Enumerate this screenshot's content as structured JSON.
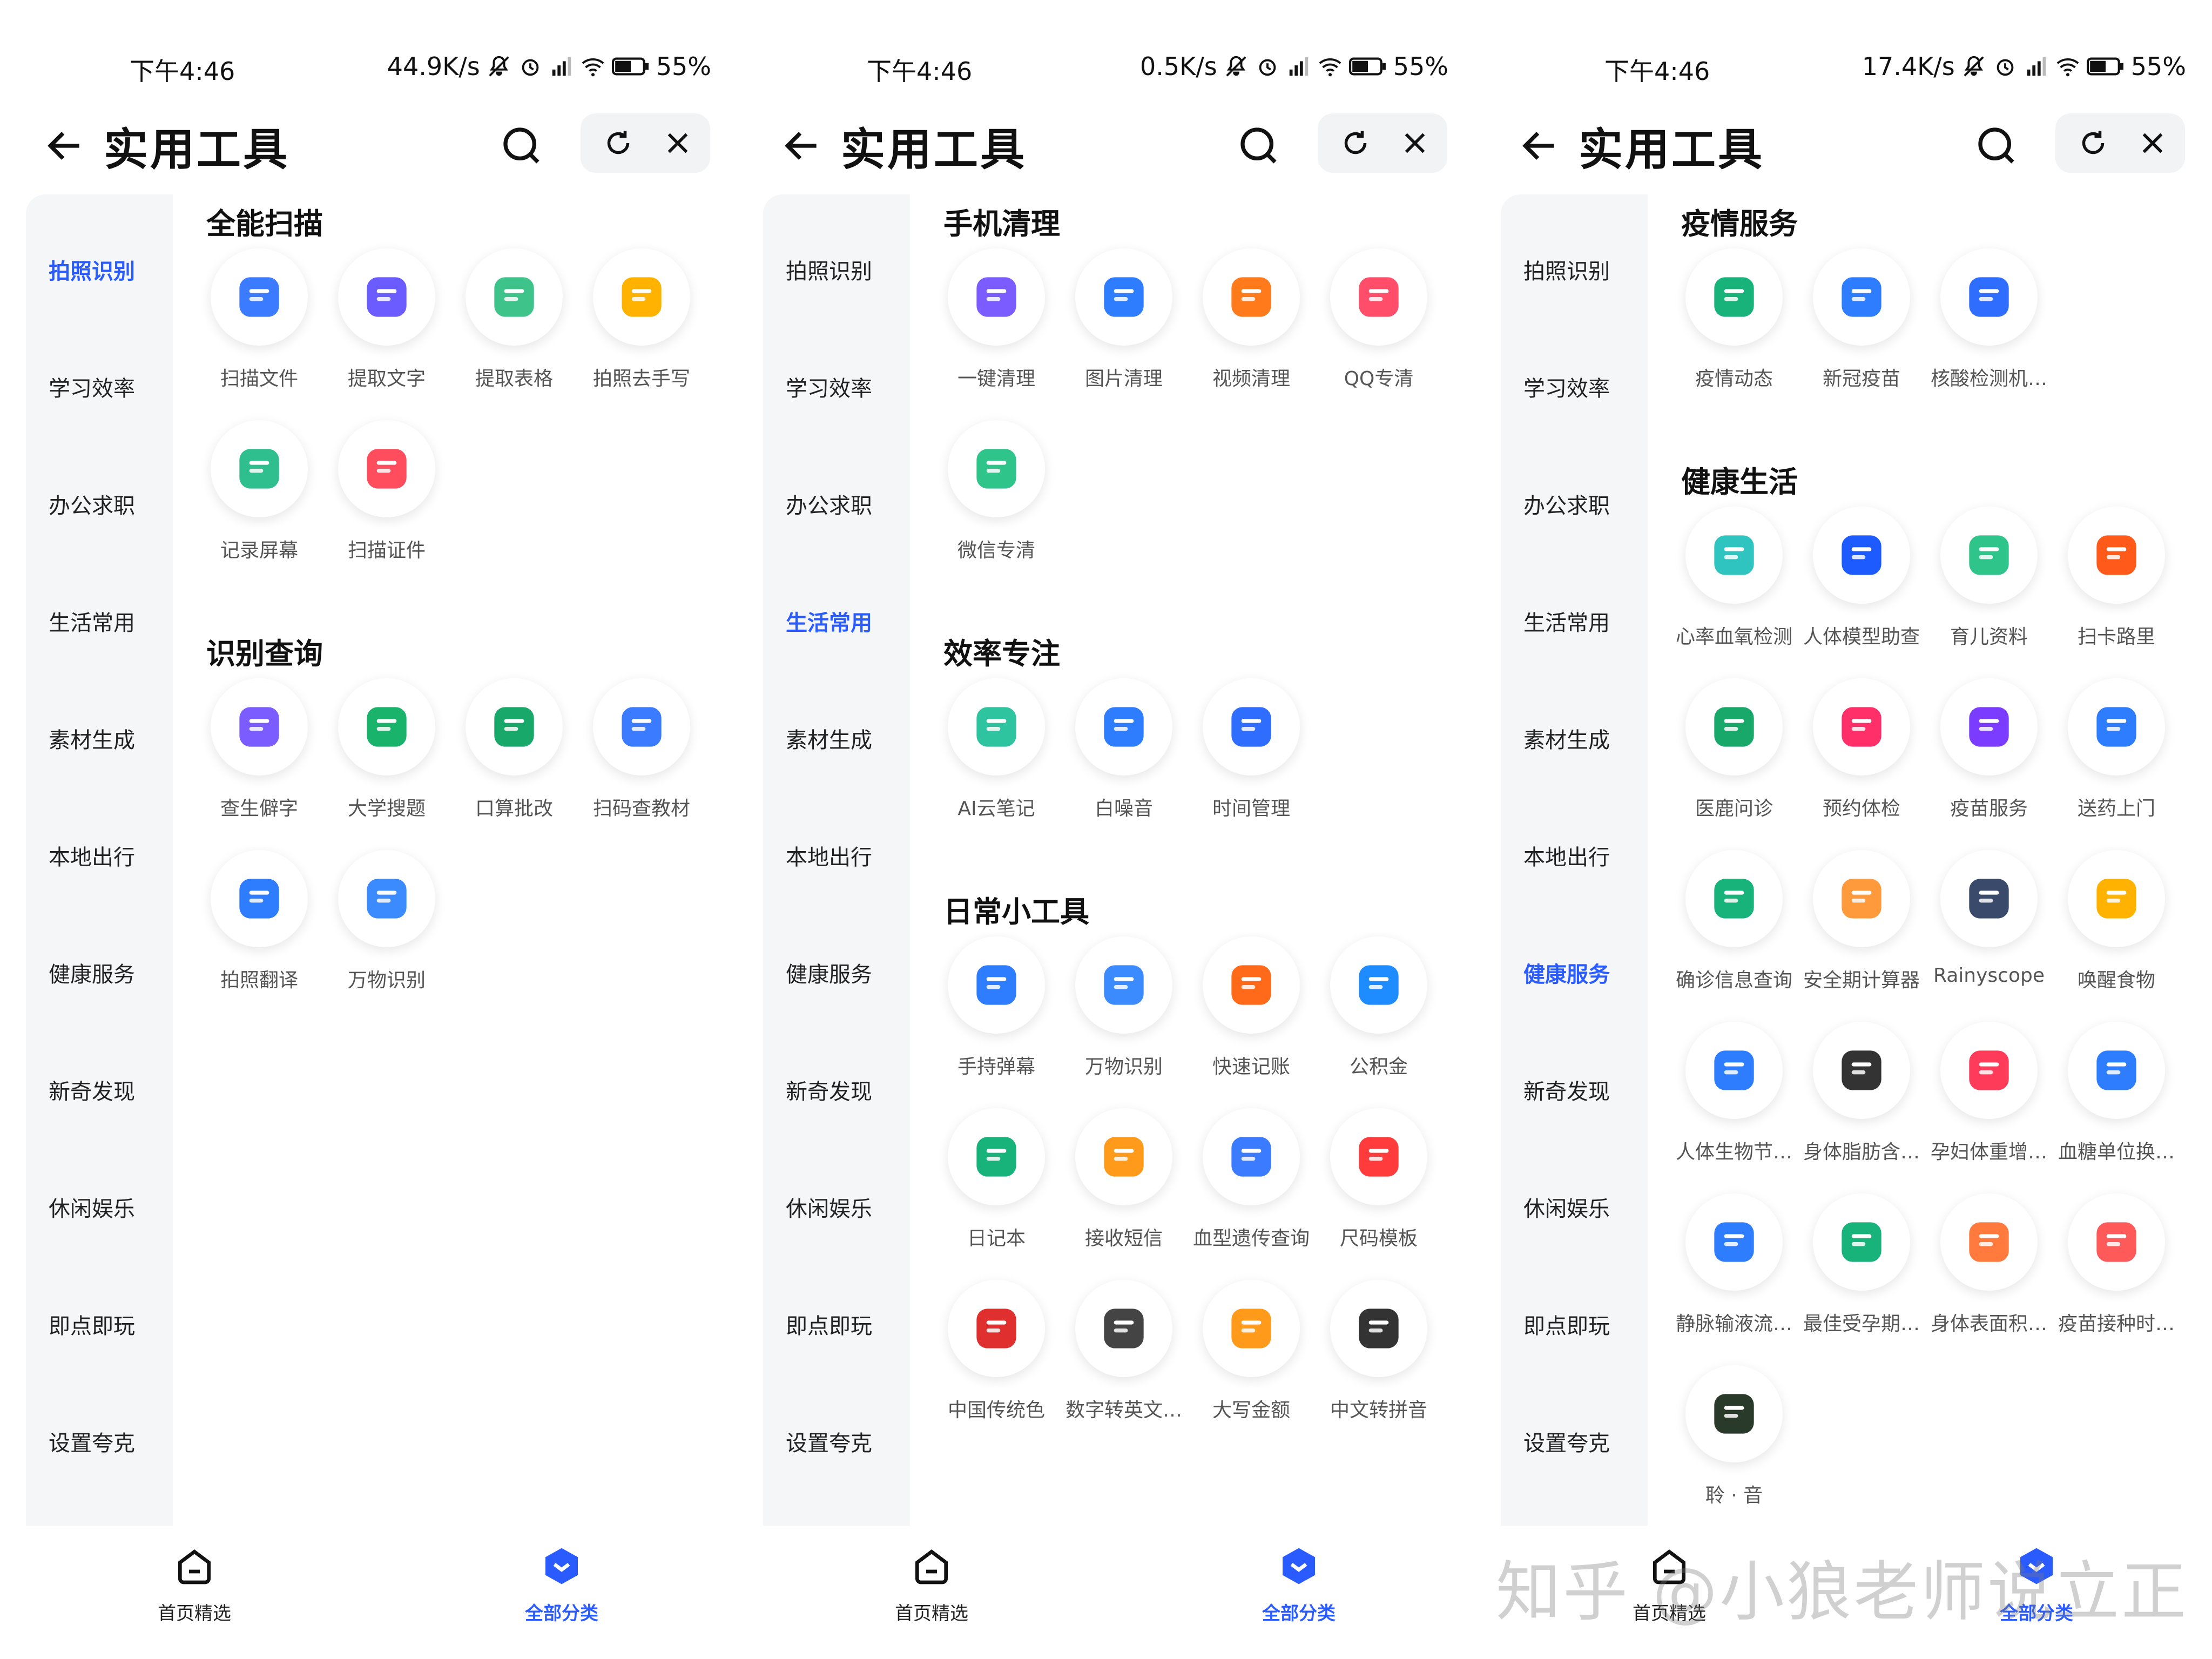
{
  "colors": {
    "accent": "#2a5bff",
    "sidebar_bg": "#f5f6f8",
    "capsule_bg": "#f2f3f5"
  },
  "screens": [
    {
      "status": {
        "time": "下午4:46",
        "speed": "44.9K/s",
        "battery": "55%"
      },
      "header": {
        "title": "实用工具"
      },
      "sidebar": [
        "拍照识别",
        "学习效率",
        "办公求职",
        "生活常用",
        "素材生成",
        "本地出行",
        "健康服务",
        "新奇发现",
        "休闲娱乐",
        "即点即玩",
        "设置夸克"
      ],
      "active_sidebar": 0,
      "sections": [
        {
          "title": "全能扫描",
          "items": [
            {
              "label": "扫描文件",
              "icon": "scan-file-icon",
              "color": "#3b7bff"
            },
            {
              "label": "提取文字",
              "icon": "extract-text-icon",
              "color": "#6a5cff"
            },
            {
              "label": "提取表格",
              "icon": "extract-table-icon",
              "color": "#3ec48a"
            },
            {
              "label": "拍照去手写",
              "icon": "remove-handwriting-icon",
              "color": "#ffb300"
            },
            {
              "label": "记录屏幕",
              "icon": "record-screen-icon",
              "color": "#2fbf8f"
            },
            {
              "label": "扫描证件",
              "icon": "scan-id-icon",
              "color": "#ff4d5e"
            }
          ]
        },
        {
          "title": "识别查询",
          "items": [
            {
              "label": "查生僻字",
              "icon": "rare-char-icon",
              "color": "#7b5cff"
            },
            {
              "label": "大学搜题",
              "icon": "college-search-icon",
              "color": "#19b36b"
            },
            {
              "label": "口算批改",
              "icon": "mental-math-icon",
              "color": "#17a86a"
            },
            {
              "label": "扫码查教材",
              "icon": "barcode-textbook-icon",
              "color": "#3b7bff"
            },
            {
              "label": "拍照翻译",
              "icon": "photo-translate-icon",
              "color": "#2f7dff"
            },
            {
              "label": "万物识别",
              "icon": "object-recognize-icon",
              "color": "#3b8bff"
            }
          ]
        }
      ]
    },
    {
      "status": {
        "time": "下午4:46",
        "speed": "0.5K/s",
        "battery": "55%"
      },
      "header": {
        "title": "实用工具"
      },
      "sidebar": [
        "拍照识别",
        "学习效率",
        "办公求职",
        "生活常用",
        "素材生成",
        "本地出行",
        "健康服务",
        "新奇发现",
        "休闲娱乐",
        "即点即玩",
        "设置夸克"
      ],
      "active_sidebar": 3,
      "sections": [
        {
          "title": "手机清理",
          "items": [
            {
              "label": "一键清理",
              "icon": "rocket-icon",
              "color": "#7b5cff"
            },
            {
              "label": "图片清理",
              "icon": "image-icon",
              "color": "#2f7dff"
            },
            {
              "label": "视频清理",
              "icon": "video-icon",
              "color": "#ff7a1a"
            },
            {
              "label": "QQ专清",
              "icon": "qq-icon",
              "color": "#ff4d6a"
            },
            {
              "label": "微信专清",
              "icon": "wechat-icon",
              "color": "#2fc48a"
            }
          ]
        },
        {
          "title": "效率专注",
          "items": [
            {
              "label": "AI云笔记",
              "icon": "ai-note-icon",
              "color": "#2fc4a0"
            },
            {
              "label": "白噪音",
              "icon": "white-noise-icon",
              "color": "#2f7dff"
            },
            {
              "label": "时间管理",
              "icon": "alarm-clock-icon",
              "color": "#2f6dff"
            }
          ]
        },
        {
          "title": "日常小工具",
          "items": [
            {
              "label": "手持弹幕",
              "icon": "bullet-screen-icon",
              "color": "#2f7dff"
            },
            {
              "label": "万物识别",
              "icon": "object-recognize-icon",
              "color": "#3b8bff"
            },
            {
              "label": "快速记账",
              "icon": "accounting-icon",
              "color": "#ff6a1a"
            },
            {
              "label": "公积金",
              "icon": "housing-fund-icon",
              "color": "#1e8cff"
            },
            {
              "label": "日记本",
              "icon": "diary-icon",
              "color": "#17b37a"
            },
            {
              "label": "接收短信",
              "icon": "sms-icon",
              "color": "#ff9a1a"
            },
            {
              "label": "血型遗传查询",
              "icon": "blood-type-icon",
              "color": "#3b7bff"
            },
            {
              "label": "尺码模板",
              "icon": "size-template-icon",
              "color": "#ff3b3b"
            },
            {
              "label": "中国传统色",
              "icon": "chinese-knot-icon",
              "color": "#e02f2f"
            },
            {
              "label": "数字转英文…",
              "icon": "number-english-icon",
              "color": "#444444"
            },
            {
              "label": "大写金额",
              "icon": "coins-icon",
              "color": "#ff9a1a"
            },
            {
              "label": "中文转拼音",
              "icon": "pinyin-icon",
              "color": "#333333"
            }
          ]
        }
      ]
    },
    {
      "status": {
        "time": "下午4:46",
        "speed": "17.4K/s",
        "battery": "55%"
      },
      "header": {
        "title": "实用工具"
      },
      "sidebar": [
        "拍照识别",
        "学习效率",
        "办公求职",
        "生活常用",
        "素材生成",
        "本地出行",
        "健康服务",
        "新奇发现",
        "休闲娱乐",
        "即点即玩",
        "设置夸克"
      ],
      "active_sidebar": 6,
      "sections": [
        {
          "title": "疫情服务",
          "items": [
            {
              "label": "疫情动态",
              "icon": "epidemic-chart-icon",
              "color": "#17b37a"
            },
            {
              "label": "新冠疫苗",
              "icon": "vaccine-shield-icon",
              "color": "#2f7dff"
            },
            {
              "label": "核酸检测机…",
              "icon": "hospital-icon",
              "color": "#2f6dff"
            }
          ]
        },
        {
          "title": "健康生活",
          "items": [
            {
              "label": "心率血氧检测",
              "icon": "heart-rate-icon",
              "color": "#2fc4c0"
            },
            {
              "label": "人体模型助查",
              "icon": "body-model-icon",
              "color": "#1e5bff"
            },
            {
              "label": "育儿资料",
              "icon": "baby-icon",
              "color": "#2fc48a"
            },
            {
              "label": "扫卡路里",
              "icon": "calorie-icon",
              "color": "#ff5a1a"
            },
            {
              "label": "医鹿问诊",
              "icon": "doctor-icon",
              "color": "#17a86a"
            },
            {
              "label": "预约体检",
              "icon": "checkup-calendar-icon",
              "color": "#ff2f6a"
            },
            {
              "label": "疫苗服务",
              "icon": "syringe-icon",
              "color": "#7b3cff"
            },
            {
              "label": "送药上门",
              "icon": "medicine-delivery-icon",
              "color": "#2f7dff"
            },
            {
              "label": "确诊信息查询",
              "icon": "paper-plane-icon",
              "color": "#17b37a"
            },
            {
              "label": "安全期计算器",
              "icon": "female-icon",
              "color": "#ff9a3c"
            },
            {
              "label": "Rainyscope",
              "icon": "rainyscope-icon",
              "color": "#3a4a6a"
            },
            {
              "label": "唤醒食物",
              "icon": "food-icon",
              "color": "#ffb300"
            },
            {
              "label": "人体生物节…",
              "icon": "biorhythm-icon",
              "color": "#2f7dff"
            },
            {
              "label": "身体脂肪含…",
              "icon": "body-fat-icon",
              "color": "#333333"
            },
            {
              "label": "孕妇体重增…",
              "icon": "pregnant-icon",
              "color": "#ff3b5a"
            },
            {
              "label": "血糖单位换…",
              "icon": "blood-drop-icon",
              "color": "#2f7dff"
            },
            {
              "label": "静脉输液流…",
              "icon": "iv-drip-icon",
              "color": "#2f7dff"
            },
            {
              "label": "最佳受孕期…",
              "icon": "fertility-icon",
              "color": "#17b37a"
            },
            {
              "label": "身体表面积…",
              "icon": "person-icon",
              "color": "#ff7a3c"
            },
            {
              "label": "疫苗接种时…",
              "icon": "vaccine-schedule-icon",
              "color": "#ff5a5a"
            },
            {
              "label": "聆 · 音",
              "icon": "listen-sound-icon",
              "color": "#2a3a2a"
            }
          ]
        }
      ]
    }
  ],
  "bottom_nav": {
    "home": "首页精选",
    "all": "全部分类"
  },
  "watermark": "知乎 @小狼老师说立正"
}
